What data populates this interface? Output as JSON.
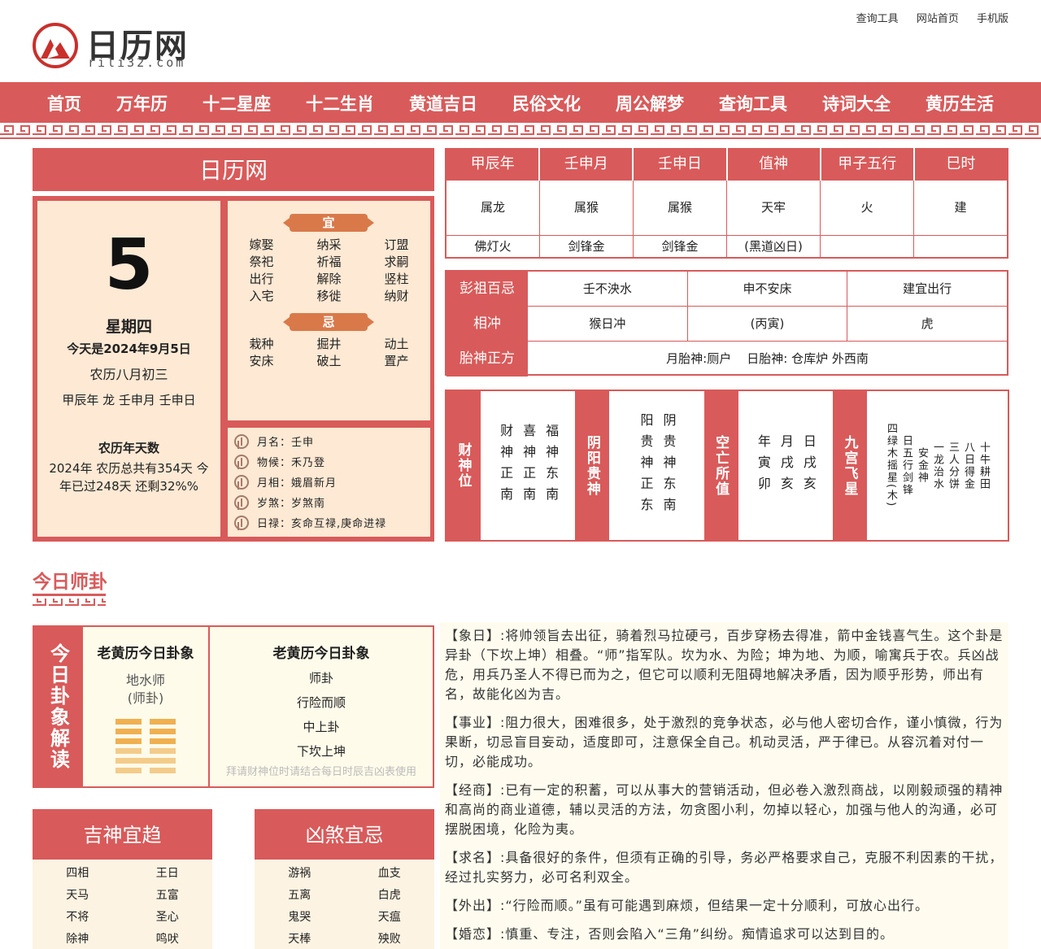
{
  "header": {
    "links": [
      "查询工具",
      "网站首页",
      "手机版"
    ],
    "logo_name": "日历网",
    "logo_sub": "rili32.com"
  },
  "nav": [
    "首页",
    "万年历",
    "十二星座",
    "十二生肖",
    "黄道吉日",
    "民俗文化",
    "周公解梦",
    "查询工具",
    "诗词大全",
    "黄历生活"
  ],
  "title": "日历网",
  "date": {
    "day": "5",
    "weekday": "星期四",
    "today": "今天是2024年9月5日",
    "lunar": "农历八月初三",
    "ganzhi": "甲辰年 龙 壬申月 壬申日",
    "yeardays_title": "农历年天数",
    "yeardays_text": "2024年 农历总共有354天 今年已过248天 还剩32%%"
  },
  "yi": {
    "label": "宜",
    "items": [
      "嫁娶",
      "纳采",
      "订盟",
      "祭祀",
      "祈福",
      "求嗣",
      "出行",
      "解除",
      "竖柱",
      "入宅",
      "移徙",
      "纳财"
    ]
  },
  "ji": {
    "label": "忌",
    "items": [
      "栽种",
      "掘井",
      "动土",
      "安床",
      "破土",
      "置产"
    ]
  },
  "info": [
    {
      "k": "月名：",
      "v": "壬申"
    },
    {
      "k": "物候：",
      "v": "禾乃登"
    },
    {
      "k": "月相：",
      "v": "娥眉新月"
    },
    {
      "k": "岁煞：",
      "v": "岁煞南"
    },
    {
      "k": "日禄：",
      "v": "亥命互禄,庚命进禄"
    }
  ],
  "top_table": {
    "heads": [
      "甲辰年",
      "壬申月",
      "壬申日",
      "值神",
      "甲子五行",
      "巳时"
    ],
    "row1": [
      "属龙",
      "属猴",
      "属猴",
      "天牢",
      "火",
      "建"
    ],
    "row2": [
      "佛灯火",
      "剑锋金",
      "剑锋金",
      "(黑道凶日)",
      "",
      ""
    ]
  },
  "pengzu": {
    "rows": [
      {
        "label": "彭祖百忌",
        "cells": [
          "壬不泱水",
          "申不安床",
          "建宜出行"
        ]
      },
      {
        "label": "相冲",
        "cells": [
          "猴日冲",
          "(丙寅)",
          "虎"
        ]
      },
      {
        "label": "胎神正方",
        "cells": [
          "月胎神:厕户    日胎神: 仓库炉 外西南"
        ]
      }
    ]
  },
  "blocks": [
    {
      "label": "财神位",
      "cols": [
        "财神正南",
        "喜神正南",
        "福神东南"
      ]
    },
    {
      "label": "阴阳贵神",
      "cols": [
        "阳贵神正东",
        "阴贵神东南"
      ]
    },
    {
      "label": "空亡所值",
      "cols": [
        "年寅卯",
        "月戌亥",
        "日戌亥"
      ]
    },
    {
      "label": "九宫飞星",
      "cols": [
        "四绿木摇星(木)",
        "日五行剑锋",
        "安金神",
        "一龙治水",
        "三人分饼",
        "八日得金",
        "十牛耕田"
      ]
    }
  ],
  "section_title": "今日师卦",
  "gua": {
    "vertical": "今日卦象解读",
    "m_head": "老黄历今日卦象",
    "m_name": "地水师",
    "m_sub": "(师卦)",
    "r_head": "老黄历今日卦象",
    "r_lines": [
      "师卦",
      "行险而顺",
      "中上卦",
      "下坎上坤"
    ],
    "note": "拜请财神位时请结合每日时辰吉凶表使用"
  },
  "paragraphs": [
    "【象日】:将帅领旨去出征，骑着烈马拉硬弓，百步穿杨去得准，箭中金钱喜气生。这个卦是异卦（下坎上坤）相叠。“师”指军队。坎为水、为险；坤为地、为顺，喻寓兵于农。兵凶战危，用兵乃圣人不得已而为之，但它可以顺利无阻碍地解决矛盾，因为顺乎形势，师出有名，故能化凶为吉。",
    "【事业】:阻力很大，困难很多，处于激烈的竞争状态，必与他人密切合作，谨小慎微，行为果断，切忌盲目妄动，适度即可，注意保全自己。机动灵活，严于律已。从容沉着对付一切，必能成功。",
    "【经商】:已有一定的积蓄，可以从事大的营销活动，但必卷入激烈商战，以刚毅顽强的精神和高尚的商业道德，辅以灵活的方法，勿贪图小利，勿掉以轻心，加强与他人的沟通，必可摆脱困境，化险为夷。",
    "【求名】:具备很好的条件，但须有正确的引导，务必严格要求自己，克服不利因素的干扰，经过扎实努力，必可名利双全。",
    "【外出】:“行险而顺。”虽有可能遇到麻烦，但结果一定十分顺利，可放心出行。",
    "【婚恋】:慎重、专注，否则会陷入“三角”纠纷。痴情追求可以达到目的。"
  ],
  "jishen": {
    "title": "吉神宜趋",
    "items": [
      "四相",
      "王日",
      "天马",
      "五富",
      "不将",
      "圣心",
      "除神",
      "鸣吠"
    ]
  },
  "xiongsha": {
    "title": "凶煞宜忌",
    "items": [
      "游祸",
      "血支",
      "五离",
      "白虎",
      "鬼哭",
      "天瘟",
      "天棒",
      "殃败"
    ]
  },
  "colors": {
    "accent": "#d95a5a",
    "panel": "#fde9d4",
    "ribbon": "#d9794a"
  }
}
